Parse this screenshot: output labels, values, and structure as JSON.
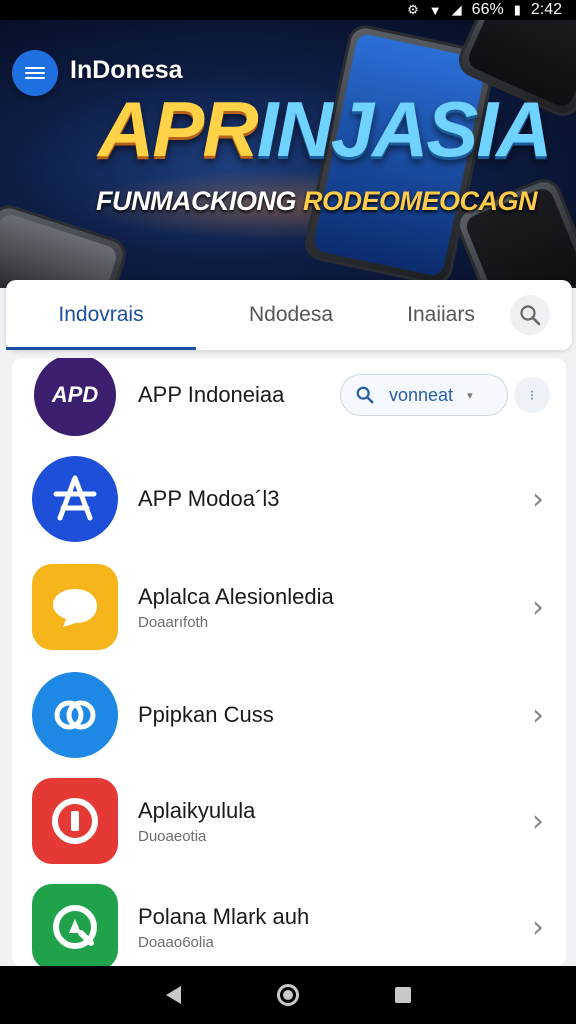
{
  "status_bar": {
    "battery": "66%",
    "time": "2:42"
  },
  "header": {
    "app_title": "InDonesa",
    "banner_title_a": "APR",
    "banner_title_b": "INJASIA",
    "banner_sub_a": "FUNMACKIONG ",
    "banner_sub_b": "RODEOMEOCAGN"
  },
  "tabs": [
    {
      "label": "Indovrais",
      "active": true
    },
    {
      "label": "Ndodesa",
      "active": false
    },
    {
      "label": "Inaiiars",
      "active": false
    }
  ],
  "apps": [
    {
      "title": "APP Indoneiaa",
      "subtitle": "",
      "icon": "apd-logo-icon",
      "icon_text": "APD",
      "color": "#3b1f6e"
    },
    {
      "title": "APP Modoa´l3",
      "subtitle": "",
      "icon": "star-a-logo-icon",
      "color": "#1d4fd8"
    },
    {
      "title": "Aplalca Alesionledia",
      "subtitle": "Doaarıfoth",
      "icon": "chat-bubble-icon",
      "color": "#f5b51b"
    },
    {
      "title": "Ppipkan Cuss",
      "subtitle": "",
      "icon": "link-logo-icon",
      "color": "#1e88e5"
    },
    {
      "title": "Aplaikyulula",
      "subtitle": "Duoaeotia",
      "icon": "record-logo-icon",
      "color": "#e53935"
    },
    {
      "title": "Polana Mlark auh",
      "subtitle": "Doaao6olia",
      "icon": "play-logo-icon",
      "color": "#1fa24a"
    }
  ],
  "connect_button": {
    "label": "vonneat"
  },
  "colors": {
    "accent": "#1f4fa0",
    "menu": "#1e6fe0"
  }
}
